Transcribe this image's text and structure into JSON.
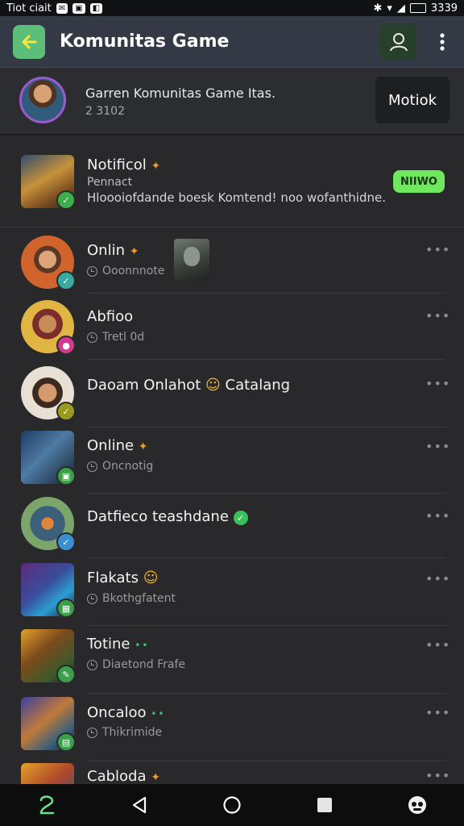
{
  "status_bar": {
    "carrier": "Tiot ciait",
    "time": "3339"
  },
  "app_bar": {
    "title": "Komunitas Game"
  },
  "community": {
    "title": "Garren Komunitas Game Itas.",
    "count": "2 3102",
    "join_label": "Motiok"
  },
  "items": [
    {
      "name": "Notificol",
      "sub": "Pennact",
      "message": "Hloooiofdande boesk Komtend! noo wofanthidne.",
      "status": "NIIWO"
    },
    {
      "name": "Onlin",
      "sub": "Ooonnnote"
    },
    {
      "name": "Abfioo",
      "sub": "Tretl 0d"
    },
    {
      "name": "Daoam Onlahot",
      "extra": "Catalang"
    },
    {
      "name": "Online",
      "sub": "Oncnotig"
    },
    {
      "name": "Datfieco",
      "extra": "teashdane"
    },
    {
      "name": "Flakats",
      "sub": "Bkothgfatent"
    },
    {
      "name": "Totine",
      "sub": "Diaetond Frafe"
    },
    {
      "name": "Oncaloo",
      "sub": "Thikrimide"
    },
    {
      "name": "Cabloda"
    }
  ]
}
